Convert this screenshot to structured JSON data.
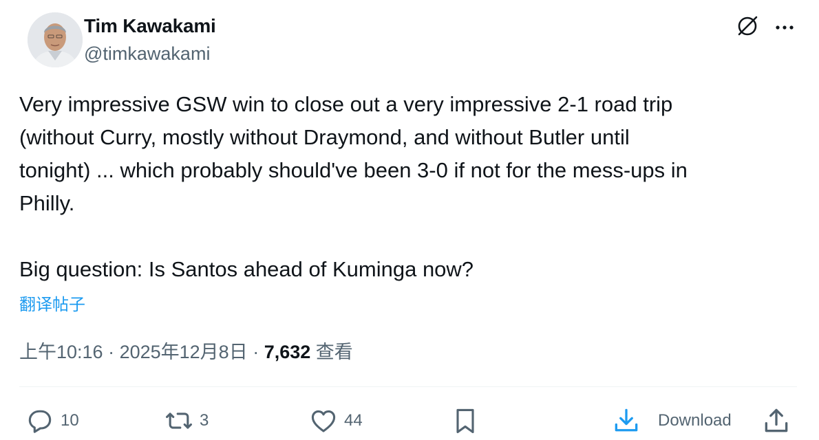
{
  "author": {
    "display_name": "Tim Kawakami",
    "handle": "@timkawakami"
  },
  "tweet": {
    "text": "Very impressive GSW win to close out a very impressive 2-1 road trip\n(without Curry, mostly without Draymond, and without Butler until\ntonight) ... which probably should've been 3-0 if not for the mess-ups in\nPhilly.\n\nBig question: Is Santos ahead of Kuminga now?",
    "translate_label": "翻译帖子"
  },
  "meta": {
    "time": "上午10:16",
    "separator": " · ",
    "date": "2025年12月8日",
    "views_count": "7,632",
    "views_label": "查看"
  },
  "actions": {
    "reply_count": "10",
    "repost_count": "3",
    "like_count": "44",
    "download_label": "Download"
  },
  "icons": {
    "grok": "grok-slash-circle-icon",
    "more": "more-horizontal-icon",
    "reply": "speech-bubble-icon",
    "repost": "repost-arrows-icon",
    "like": "heart-icon",
    "bookmark": "bookmark-icon",
    "download": "download-arrow-icon",
    "share": "share-upload-icon"
  },
  "colors": {
    "text_primary": "#0f1419",
    "text_secondary": "#536471",
    "link": "#1d9bf0",
    "download_icon": "#1d9bf0",
    "divider": "#eff3f4"
  }
}
